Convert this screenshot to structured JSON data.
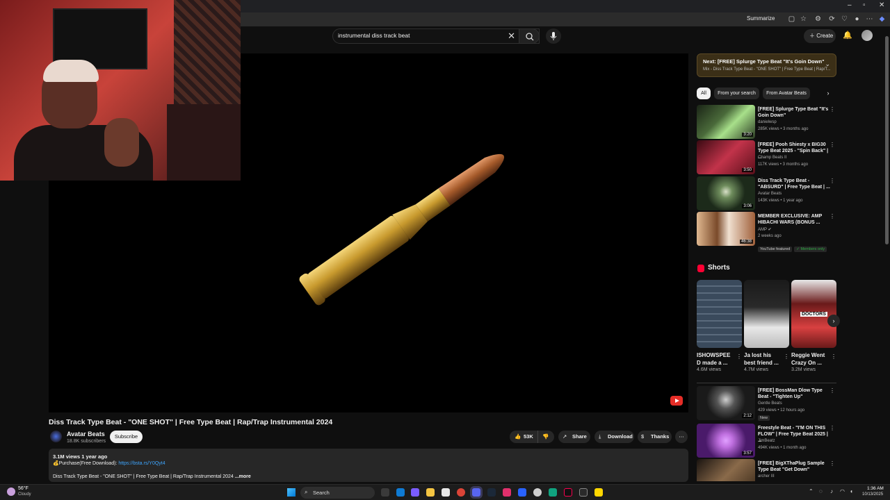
{
  "browser": {
    "summarize_label": "Summarize",
    "window_controls": [
      "–",
      "▫",
      "✕"
    ]
  },
  "header": {
    "search_value": "instrumental diss track beat",
    "create_label": "Create"
  },
  "video": {
    "title": "Diss Track Type Beat - \"ONE SHOT\" | Free Type Beat | Rap/Trap Instrumental 2024",
    "channel": "Avatar Beats",
    "subscribers": "18.8K subscribers",
    "subscribe_label": "Subscribe",
    "likes": "53K",
    "share_label": "Share",
    "download_label": "Download",
    "thanks_label": "Thanks",
    "more_label": "⋯",
    "views_date": "3.1M views  1 year ago",
    "purchase_prefix": "💰Purchase(Free Download): ",
    "purchase_link": "https://bsta.rs/Y0Qyt4",
    "desc_line": "Diss Track Type Beat - \"ONE SHOT\" | Free Type Beat | Rap/Trap Instrumental 2024",
    "more_link": " ...more"
  },
  "next": {
    "title": "Next: [FREE] Splurge Type Beat \"It's Goin Down\"",
    "subtitle": "Mix - Diss Track Type Beat - \"ONE SHOT\" | Free Type Beat | Rap/T..."
  },
  "chips": [
    "All",
    "From your search",
    "From Avatar Beats",
    "›"
  ],
  "recommendations": [
    {
      "title": "[FREE] Splurge Type Beat \"It's Goin Down\"",
      "channel": "danielwsp",
      "meta": "285K views • 3 months ago",
      "duration": "3:20",
      "colors": [
        "#2a3a22",
        "#8fd47a"
      ]
    },
    {
      "title": "[FREE] Pooh Shiesty x BIG30 Type Beat 2025 - \"Spin Back\" | ...",
      "channel": "Champ Beats II",
      "meta": "117K views • 3 months ago",
      "duration": "3:50",
      "colors": [
        "#5a0f1a",
        "#c2334a"
      ]
    },
    {
      "title": "Diss Track Type Beat - \"ABSURD\" | Free Type Beat | ...",
      "channel": "Avatar Beats",
      "meta": "143K views • 1 year ago",
      "duration": "3:06",
      "colors": [
        "#1c2a1a",
        "#6e8c5c"
      ]
    },
    {
      "title": "MEMBER EXCLUSIVE: AMP HIBACHI WARS (BONUS ...",
      "channel": "AMP ✔",
      "meta": "2 weeks ago",
      "duration": "46:38",
      "colors": [
        "#7a4a2a",
        "#e0b890"
      ],
      "badges": [
        "YouTube featured",
        "✓ Members only"
      ]
    }
  ],
  "shorts": {
    "title": "Shorts",
    "items": [
      {
        "title": "ISHOWSPEE D made a ...",
        "views": "4.6M views",
        "colors": [
          "#3a4a5c",
          "#8aa0b8"
        ]
      },
      {
        "title": "Ja lost his best friend ...",
        "views": "4.7M views",
        "colors": [
          "#2a2a2a",
          "#e8e8e8"
        ]
      },
      {
        "title": "Reggie Went Crazy On ...",
        "views": "3.2M views",
        "colors": [
          "#6a1a1a",
          "#d84040"
        ]
      }
    ],
    "overlay_text": "DOCTORS"
  },
  "more_recommendations": [
    {
      "title": "[FREE] BossMan Dlow Type Beat - \"Tighten Up\"",
      "channel": "Gentle Beats",
      "meta": "429 views • 12 hours ago",
      "duration": "2:12",
      "badge": "New",
      "colors": [
        "#2a2a2a",
        "#cfcfcf"
      ]
    },
    {
      "title": "Freestyle Beat - \"I'M ON THIS FLOW\" | Free Type Beat 2025 | ...",
      "channel": "JimBeatz",
      "meta": "494K views • 1 month ago",
      "duration": "3:57",
      "colors": [
        "#4a1a6a",
        "#c070e0"
      ]
    },
    {
      "title": "[FREE] BigXThaPlug Sample Type Beat \"Get Down\"",
      "channel": "archer III",
      "meta": "",
      "duration": "",
      "colors": [
        "#3a2a1a",
        "#8a6a4a"
      ]
    }
  ],
  "taskbar": {
    "temperature": "56°F",
    "condition": "Cloudy",
    "search_label": "Search",
    "time": "1:36 AM",
    "date": "10/13/2025"
  },
  "colors": {
    "accent_red": "#ff0033",
    "link_blue": "#3ea6ff",
    "members_green": "#2ba640"
  }
}
